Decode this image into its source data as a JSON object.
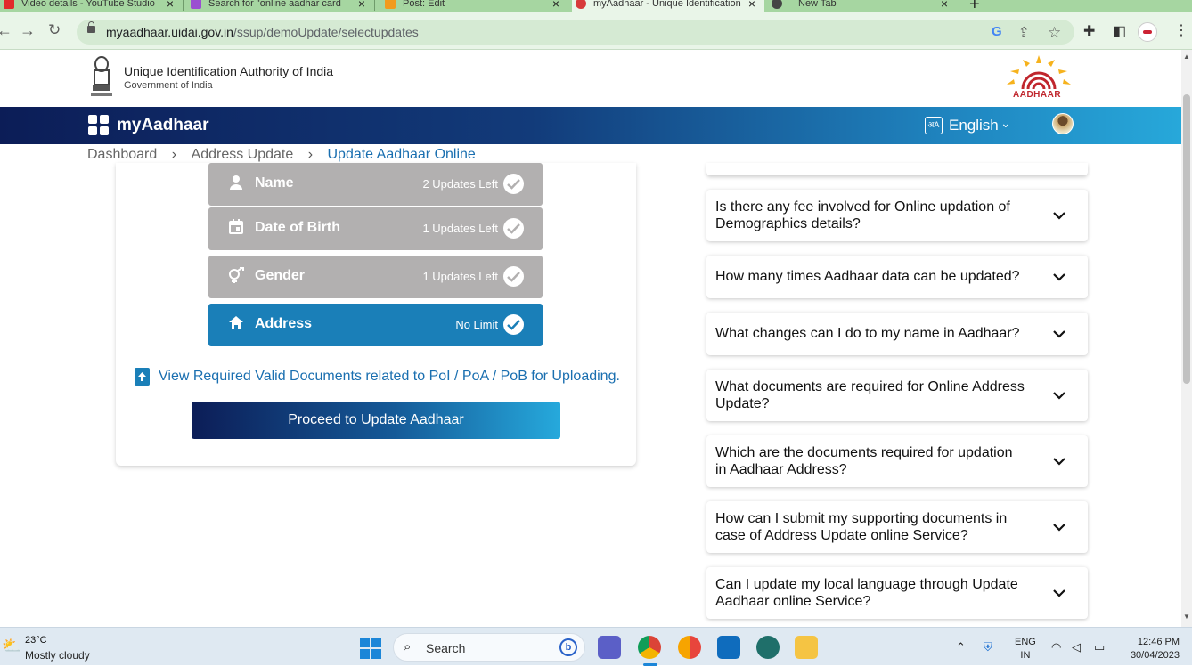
{
  "browser": {
    "tabs": [
      {
        "title": "Video details - YouTube Studio",
        "icon_color": "#e22b2b"
      },
      {
        "title": "Search for \"online aadhar card",
        "icon_color": "#9b4fd1"
      },
      {
        "title": "Post: Edit",
        "icon_color": "#f29b1d"
      },
      {
        "title": "myAadhaar - Unique Identification",
        "icon_color": "#d73a3a"
      },
      {
        "title": "New Tab",
        "icon_color": "#444444"
      }
    ],
    "url_host": "myaadhaar.uidai.gov.in",
    "url_path": "/ssup/demoUpdate/selectupdates"
  },
  "header": {
    "org_title": "Unique Identification Authority of India",
    "org_subtitle": "Government of India",
    "logo_text": "AADHAAR"
  },
  "navbar": {
    "brand": "myAadhaar",
    "language": "English"
  },
  "breadcrumb": {
    "items": [
      "Dashboard",
      "Address Update",
      "Update Aadhaar Online"
    ]
  },
  "update_options": [
    {
      "label": "Name",
      "count": "2 Updates Left",
      "icon": "person-icon",
      "active": false
    },
    {
      "label": "Date of Birth",
      "count": "1 Updates Left",
      "icon": "calendar-icon",
      "active": false
    },
    {
      "label": "Gender",
      "count": "1 Updates Left",
      "icon": "gender-icon",
      "active": false
    },
    {
      "label": "Address",
      "count": "No Limit",
      "icon": "home-icon",
      "active": true
    }
  ],
  "doc_link": "View Required Valid Documents related to PoI / PoA / PoB for Uploading.",
  "proceed_button": "Proceed to Update Aadhaar",
  "faqs": [
    "Is there any fee involved for Online updation of Demographics details?",
    "How many times Aadhaar data can be updated?",
    "What changes can I do to my name in Aadhaar?",
    "What documents are required for Online Address Update?",
    "Which are the documents required for updation in Aadhaar Address?",
    "How can I submit my supporting documents in case of Address Update online Service?",
    "Can I update my local language through Update Aadhaar online Service?"
  ],
  "taskbar": {
    "temperature": "23°C",
    "weather": "Mostly cloudy",
    "search_label": "Search",
    "lang_line1": "ENG",
    "lang_line2": "IN",
    "time": "12:46 PM",
    "date": "30/04/2023"
  },
  "colors": {
    "accent_blue": "#1a7fb8",
    "navbar_dark": "#0c1d57",
    "disabled_grey": "#b2b0b0"
  }
}
